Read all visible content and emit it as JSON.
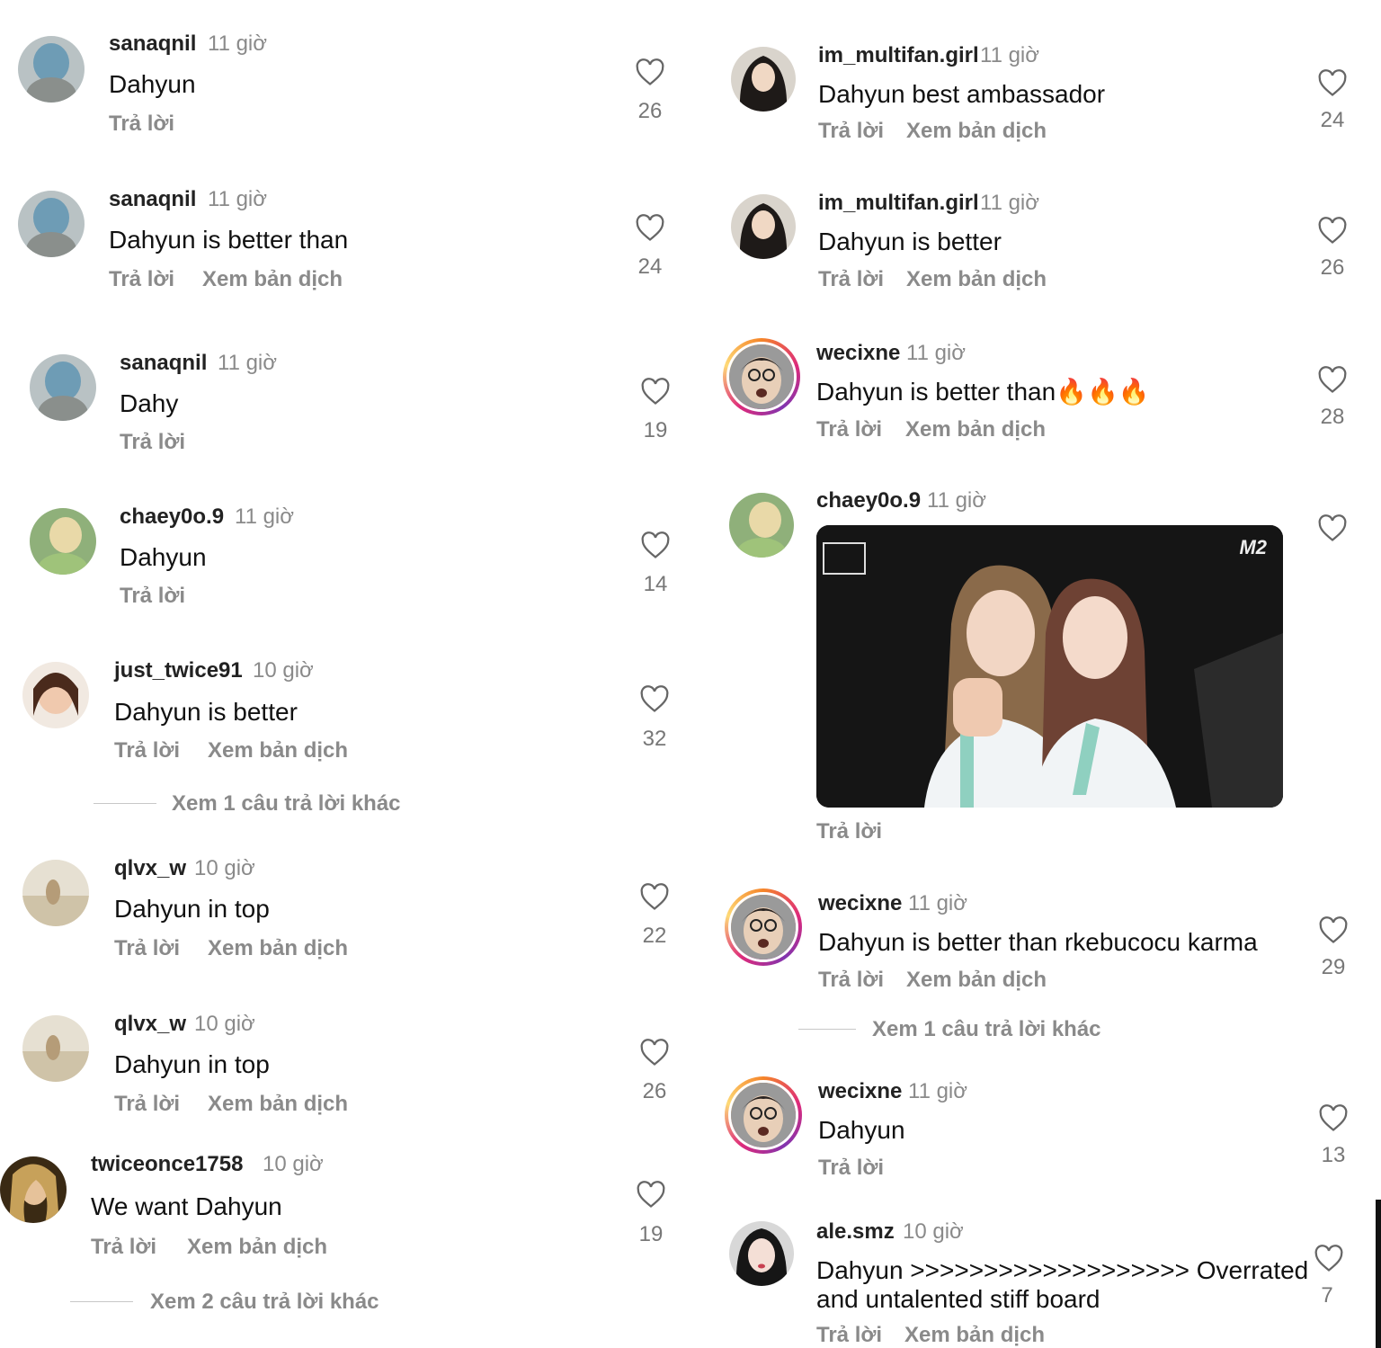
{
  "left": [
    {
      "username": "sanaqnil",
      "time": "11 giờ",
      "text": "Dahyun",
      "reply": "Trả lời",
      "translate": "",
      "likes": "26"
    },
    {
      "username": "sanaqnil",
      "time": "11 giờ",
      "text": "Dahyun is better than",
      "reply": "Trả lời",
      "translate": "Xem bản dịch",
      "likes": "24"
    },
    {
      "username": "sanaqnil",
      "time": "11 giờ",
      "text": "Dahy",
      "reply": "Trả lời",
      "translate": "",
      "likes": "19"
    },
    {
      "username": "chaey0o.9",
      "time": "11 giờ",
      "text": "Dahyun",
      "reply": "Trả lời",
      "translate": "",
      "likes": "14"
    },
    {
      "username": "just_twice91",
      "time": "10 giờ",
      "text": "Dahyun is better",
      "reply": "Trả lời",
      "translate": "Xem bản dịch",
      "likes": "32",
      "more": "Xem 1 câu trả lời khác"
    },
    {
      "username": "qlvx_w",
      "time": "10 giờ",
      "text": "Dahyun in top",
      "reply": "Trả lời",
      "translate": "Xem bản dịch",
      "likes": "22"
    },
    {
      "username": "qlvx_w",
      "time": "10 giờ",
      "text": "Dahyun in top",
      "reply": "Trả lời",
      "translate": "Xem bản dịch",
      "likes": "26"
    },
    {
      "username": "twiceonce1758",
      "time": "10 giờ",
      "text": "We want Dahyun",
      "reply": "Trả lời",
      "translate": "Xem bản dịch",
      "likes": "19",
      "more": "Xem 2 câu trả lời khác"
    }
  ],
  "right": [
    {
      "username": "im_multifan.girl",
      "time": "11 giờ",
      "text": "Dahyun best ambassador",
      "reply": "Trả lời",
      "translate": "Xem bản dịch",
      "likes": "24"
    },
    {
      "username": "im_multifan.girl",
      "time": "11 giờ",
      "text": "Dahyun is better",
      "reply": "Trả lời",
      "translate": "Xem bản dịch",
      "likes": "26"
    },
    {
      "username": "wecixne",
      "time": "11 giờ",
      "text": "Dahyun is better than",
      "emoji": "🔥🔥🔥",
      "reply": "Trả lời",
      "translate": "Xem bản dịch",
      "likes": "28"
    },
    {
      "username": "chaey0o.9",
      "time": "11 giờ",
      "text": "",
      "gif_badge": "M2",
      "reply": "Trả lời",
      "translate": "",
      "likes": ""
    },
    {
      "username": "wecixne",
      "time": "11 giờ",
      "text": "Dahyun is better than rkebucocu karma",
      "reply": "Trả lời",
      "translate": "Xem bản dịch",
      "likes": "29",
      "more": "Xem 1 câu trả lời khác"
    },
    {
      "username": "wecixne",
      "time": "11 giờ",
      "text": "Dahyun",
      "reply": "Trả lời",
      "translate": "",
      "likes": "13"
    },
    {
      "username": "ale.smz",
      "time": "10 giờ",
      "text": "Dahyun >>>>>>>>>>>>>>>>>>> Overrated",
      "text2": "and untalented stiff board",
      "reply": "Trả lời",
      "translate": "Xem bản dịch",
      "likes": "7"
    }
  ],
  "icons": {
    "like": "heart-outline-icon"
  },
  "colors": {
    "muted": "#8a8a8a",
    "text": "#111111",
    "story_ring": "#dd2a7b"
  }
}
